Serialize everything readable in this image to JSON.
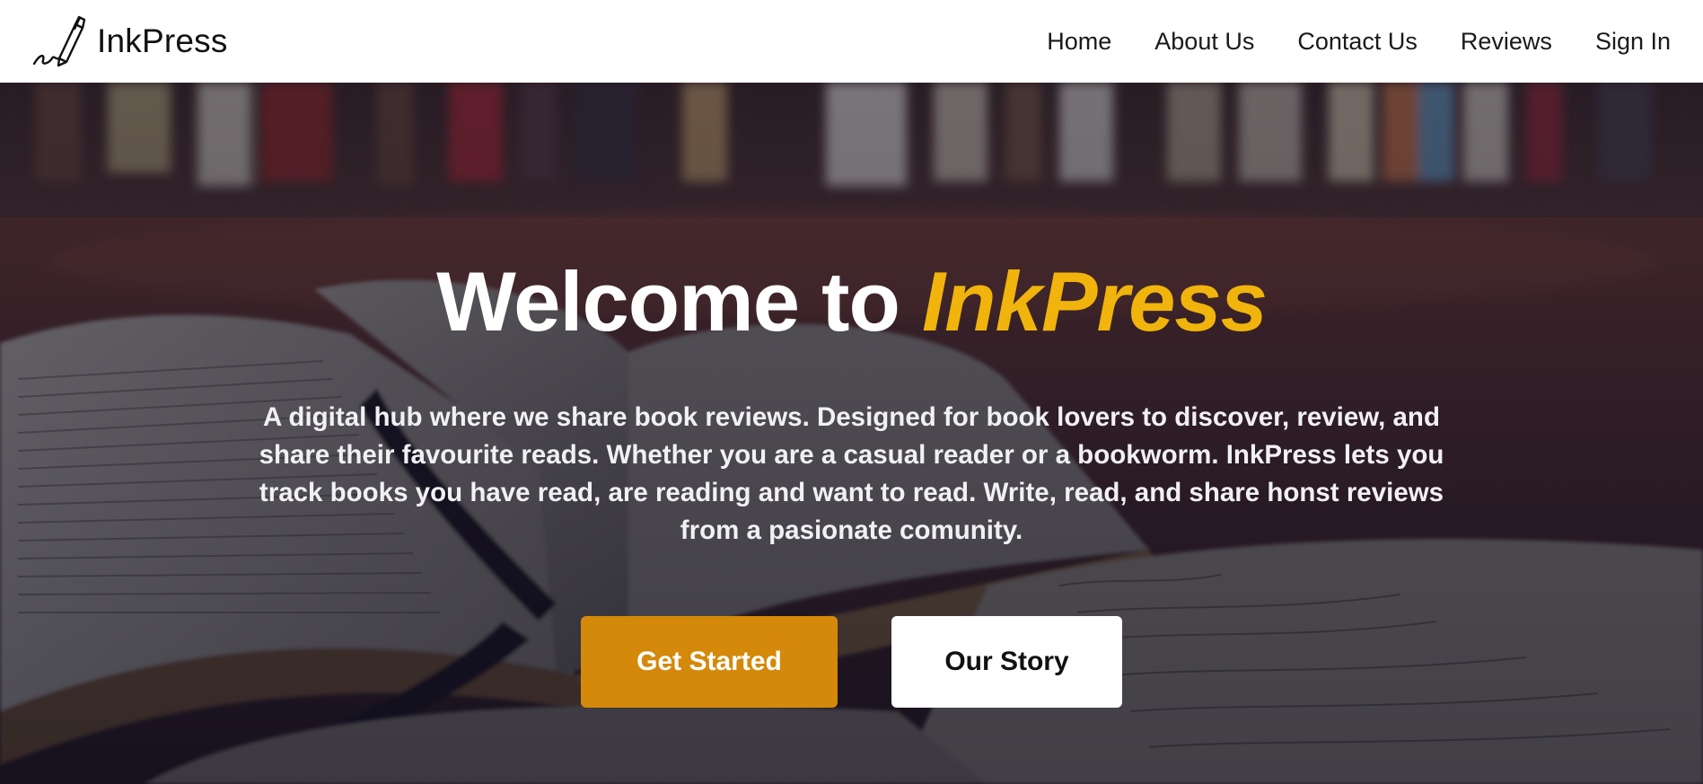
{
  "brand": {
    "name": "InkPress",
    "logo_icon": "pen-signature-icon"
  },
  "nav": {
    "items": [
      {
        "label": "Home"
      },
      {
        "label": "About Us"
      },
      {
        "label": "Contact Us"
      },
      {
        "label": "Reviews"
      },
      {
        "label": "Sign In"
      }
    ]
  },
  "hero": {
    "title_prefix": "Welcome to ",
    "title_brand": "InkPress",
    "description": "A digital hub where we share book reviews. Designed for book lovers to discover, review, and share their favourite reads. Whether you are a casual reader or a bookworm. InkPress lets you track books you have read, are reading and want to read. Write, read, and share honst reviews from a pasionate comunity.",
    "primary_button": "Get Started",
    "secondary_button": "Our Story"
  },
  "colors": {
    "accent": "#f0b40c",
    "primary_button": "#d4890a",
    "navbar_bg": "#ffffff",
    "hero_overlay": "#14122a"
  }
}
